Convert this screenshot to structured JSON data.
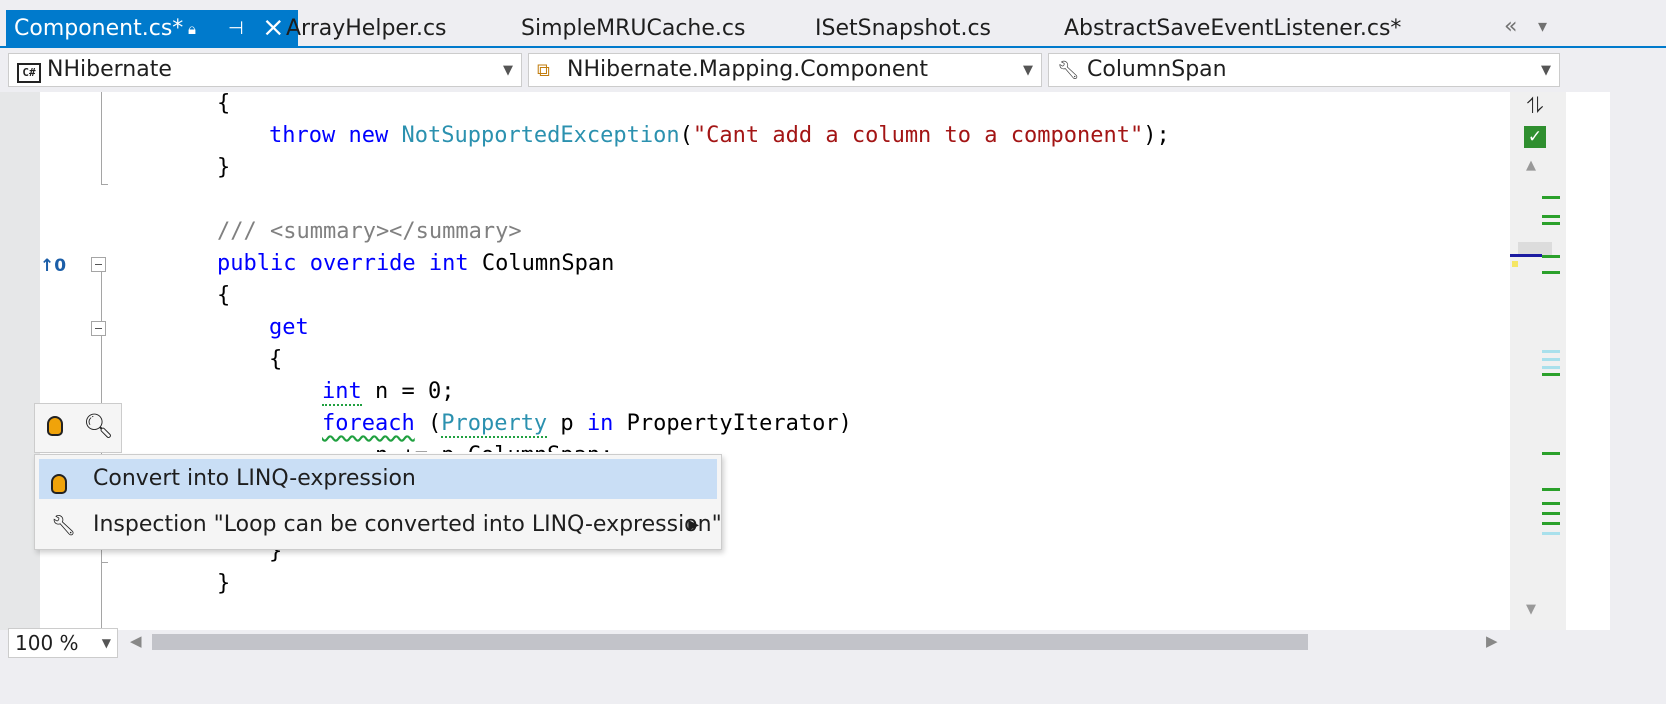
{
  "tabs": [
    {
      "label": "Component.cs*",
      "active": true
    },
    {
      "label": "ArrayHelper.cs"
    },
    {
      "label": "SimpleMRUCache.cs"
    },
    {
      "label": "ISetSnapshot.cs"
    },
    {
      "label": "AbstractSaveEventListener.cs*"
    }
  ],
  "nav": {
    "project": "NHibernate",
    "type": "NHibernate.Mapping.Component",
    "member": "ColumnSpan"
  },
  "codelens": "0",
  "code": {
    "l1": "{",
    "l2_kw1": "throw",
    "l2_kw2": "new",
    "l2_type": "NotSupportedException",
    "l2_p1": "(",
    "l2_str": "\"Cant add a column to a component\"",
    "l2_p2": ");",
    "l3": "}",
    "l5": "/// <summary></summary>",
    "l6_kw": "public override int",
    "l6_name": "ColumnSpan",
    "l7": "{",
    "l8_kw": "get",
    "l9": "{",
    "l10_kw": "int",
    "l10_rest": " n = 0;",
    "l11_kw": "foreach",
    "l11_p": " (",
    "l11_type": "Property",
    "l11_var": " p ",
    "l11_in": "in",
    "l11_rest": " PropertyIterator)",
    "l12": "n += p.ColumnSpan;",
    "l15": "}",
    "l16": "}"
  },
  "popup": {
    "items": [
      {
        "label": "Convert into LINQ-expression",
        "icon": "lightbulb-icon"
      },
      {
        "label": "Inspection \"Loop can be converted into LINQ-expression\"",
        "icon": "wrench-icon"
      }
    ]
  },
  "zoom": "100 %",
  "colors": {
    "accent": "#007acc",
    "keyword": "#0000ff",
    "type": "#2b91af",
    "string": "#a31515",
    "comment": "#808080",
    "highlight": "#c9def5"
  }
}
